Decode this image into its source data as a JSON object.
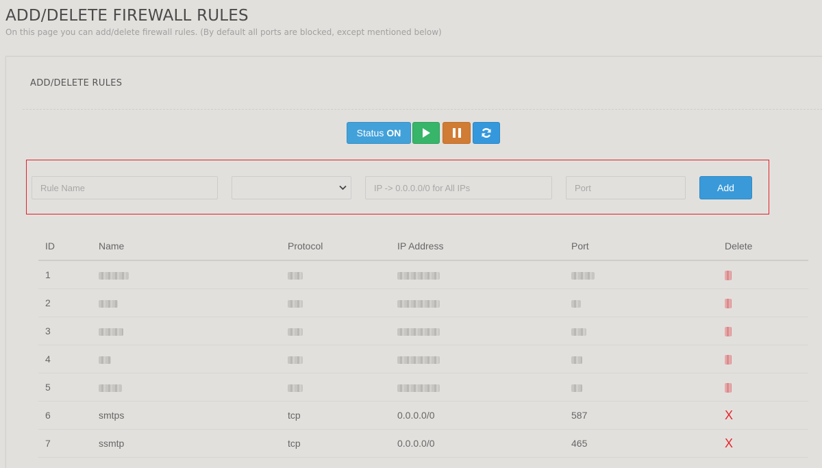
{
  "page": {
    "title": "ADD/DELETE FIREWALL RULES",
    "subtitle": "On this page you can add/delete firewall rules. (By default all ports are blocked, except mentioned below)"
  },
  "panel": {
    "title": "ADD/DELETE RULES"
  },
  "status_bar": {
    "status_label": "Status",
    "status_value": "ON",
    "play_icon": "play-icon",
    "pause_icon": "pause-icon",
    "refresh_icon": "refresh-icon"
  },
  "form": {
    "rule_name_placeholder": "Rule Name",
    "protocol_value": "",
    "ip_placeholder": "IP -> 0.0.0.0/0 for All IPs",
    "port_placeholder": "Port",
    "add_label": "Add"
  },
  "table": {
    "headers": [
      "ID",
      "Name",
      "Protocol",
      "IP Address",
      "Port",
      "Delete"
    ],
    "rows": [
      {
        "id": "1",
        "name": "",
        "protocol": "",
        "ip": "",
        "port": "",
        "delete": "",
        "redacted": true
      },
      {
        "id": "2",
        "name": "",
        "protocol": "",
        "ip": "",
        "port": "",
        "delete": "",
        "redacted": true
      },
      {
        "id": "3",
        "name": "",
        "protocol": "",
        "ip": "",
        "port": "",
        "delete": "",
        "redacted": true
      },
      {
        "id": "4",
        "name": "",
        "protocol": "",
        "ip": "",
        "port": "",
        "delete": "",
        "redacted": true
      },
      {
        "id": "5",
        "name": "",
        "protocol": "",
        "ip": "",
        "port": "",
        "delete": "",
        "redacted": true
      },
      {
        "id": "6",
        "name": "smtps",
        "protocol": "tcp",
        "ip": "0.0.0.0/0",
        "port": "587",
        "delete": "X",
        "redacted": false
      },
      {
        "id": "7",
        "name": "ssmtp",
        "protocol": "tcp",
        "ip": "0.0.0.0/0",
        "port": "465",
        "delete": "X",
        "redacted": false
      }
    ]
  },
  "colors": {
    "status_button": "#42a1d9",
    "play_button": "#37b569",
    "pause_button": "#d07c35",
    "refresh_button": "#3598dc",
    "add_button": "#3a9ad9",
    "highlight_border": "#e11f25",
    "delete_x": "#e8252c"
  }
}
